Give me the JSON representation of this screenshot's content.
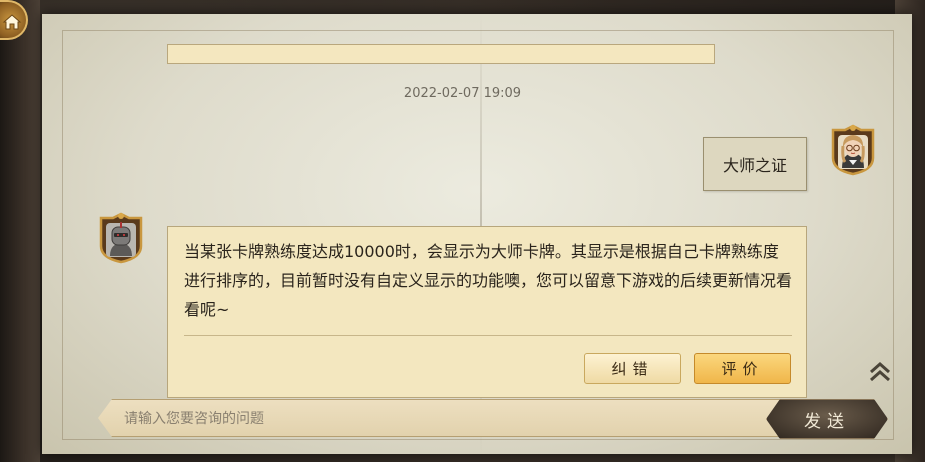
{
  "header": {
    "home_icon": "home-icon"
  },
  "chat": {
    "timestamp": "2022-02-07 19:09",
    "user_message": "大师之证",
    "bot_message": "当某张卡牌熟练度达成10000时，会显示为大师卡牌。其显示是根据自己卡牌熟练度进行排序的，目前暂时没有自定义显示的功能噢，您可以留意下游戏的后续更新情况看看呢~",
    "actions": {
      "correct_label": "纠错",
      "rate_label": "评价"
    }
  },
  "composer": {
    "placeholder": "请输入您要咨询的问题",
    "value": "",
    "send_label": "发送"
  },
  "colors": {
    "paper": "#e4e1d2",
    "bot_bubble": "#f3e7bf",
    "rate_button": "#f0b64a",
    "send_button": "#3e342a"
  }
}
